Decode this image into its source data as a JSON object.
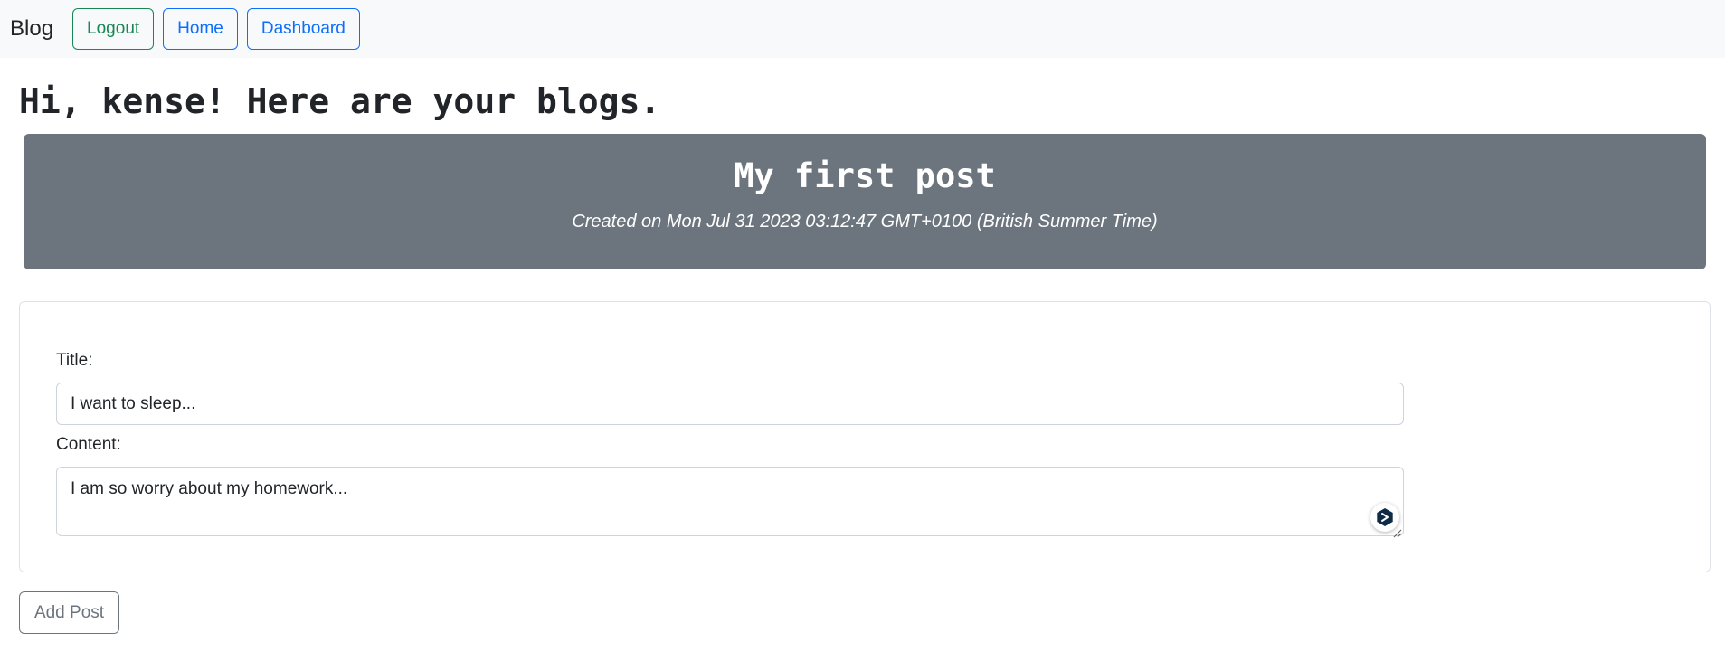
{
  "navbar": {
    "brand": "Blog",
    "logout_label": "Logout",
    "home_label": "Home",
    "dashboard_label": "Dashboard"
  },
  "greeting": "Hi, kense! Here are your blogs.",
  "post": {
    "title": "My first post",
    "created": "Created on Mon Jul 31 2023 03:12:47 GMT+0100 (British Summer Time)"
  },
  "form": {
    "title_label": "Title:",
    "title_value": "I want to sleep...",
    "content_label": "Content:",
    "content_value": "I am so worry about my homework...",
    "submit_label": "Add Post"
  },
  "colors": {
    "navbar_bg": "#f8f9fa",
    "success": "#198754",
    "primary": "#0d6efd",
    "secondary": "#6c757d"
  },
  "icons": {
    "assistant": "assistant-icon",
    "resize": "resize-handle-icon"
  }
}
